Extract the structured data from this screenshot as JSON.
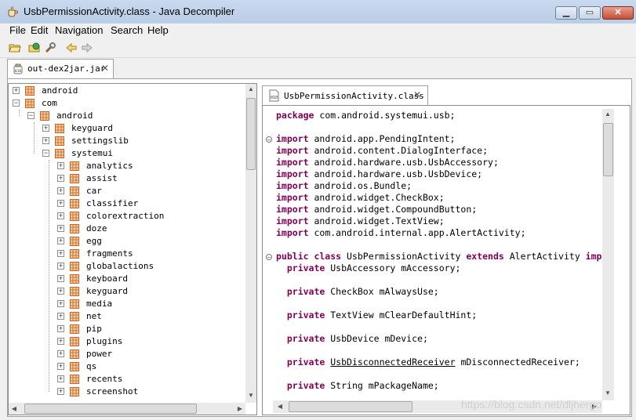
{
  "window": {
    "title": "UsbPermissionActivity.class - Java Decompiler"
  },
  "menu": [
    "File",
    "Edit",
    "Navigation",
    "Search",
    "Help"
  ],
  "toolbar": {
    "icons": [
      "open-folder-icon",
      "open-type-icon",
      "wrench-icon",
      "back-arrow-icon",
      "forward-arrow-icon"
    ]
  },
  "outer_tab": {
    "label": "out-dex2jar.jar"
  },
  "tree": [
    {
      "label": "android",
      "depth": 0,
      "expanded": false
    },
    {
      "label": "com",
      "depth": 0,
      "expanded": true
    },
    {
      "label": "android",
      "depth": 1,
      "expanded": true
    },
    {
      "label": "keyguard",
      "depth": 2,
      "expanded": false
    },
    {
      "label": "settingslib",
      "depth": 2,
      "expanded": false
    },
    {
      "label": "systemui",
      "depth": 2,
      "expanded": true
    },
    {
      "label": "analytics",
      "depth": 3,
      "expanded": false
    },
    {
      "label": "assist",
      "depth": 3,
      "expanded": false
    },
    {
      "label": "car",
      "depth": 3,
      "expanded": false
    },
    {
      "label": "classifier",
      "depth": 3,
      "expanded": false
    },
    {
      "label": "colorextraction",
      "depth": 3,
      "expanded": false
    },
    {
      "label": "doze",
      "depth": 3,
      "expanded": false
    },
    {
      "label": "egg",
      "depth": 3,
      "expanded": false
    },
    {
      "label": "fragments",
      "depth": 3,
      "expanded": false
    },
    {
      "label": "globalactions",
      "depth": 3,
      "expanded": false
    },
    {
      "label": "keyboard",
      "depth": 3,
      "expanded": false
    },
    {
      "label": "keyguard",
      "depth": 3,
      "expanded": false
    },
    {
      "label": "media",
      "depth": 3,
      "expanded": false
    },
    {
      "label": "net",
      "depth": 3,
      "expanded": false
    },
    {
      "label": "pip",
      "depth": 3,
      "expanded": false
    },
    {
      "label": "plugins",
      "depth": 3,
      "expanded": false
    },
    {
      "label": "power",
      "depth": 3,
      "expanded": false
    },
    {
      "label": "qs",
      "depth": 3,
      "expanded": false
    },
    {
      "label": "recents",
      "depth": 3,
      "expanded": false
    },
    {
      "label": "screenshot",
      "depth": 3,
      "expanded": false
    }
  ],
  "code_tab": {
    "label": "UsbPermissionActivity.class"
  },
  "code": [
    {
      "parts": [
        {
          "t": "package",
          "k": true
        },
        {
          "t": " com.android.systemui.usb;"
        }
      ]
    },
    {
      "parts": []
    },
    {
      "parts": [
        {
          "t": "import",
          "k": true
        },
        {
          "t": " android.app.PendingIntent;"
        }
      ],
      "fold": true
    },
    {
      "parts": [
        {
          "t": "import",
          "k": true
        },
        {
          "t": " android.content.DialogInterface;"
        }
      ]
    },
    {
      "parts": [
        {
          "t": "import",
          "k": true
        },
        {
          "t": " android.hardware.usb.UsbAccessory;"
        }
      ]
    },
    {
      "parts": [
        {
          "t": "import",
          "k": true
        },
        {
          "t": " android.hardware.usb.UsbDevice;"
        }
      ]
    },
    {
      "parts": [
        {
          "t": "import",
          "k": true
        },
        {
          "t": " android.os.Bundle;"
        }
      ]
    },
    {
      "parts": [
        {
          "t": "import",
          "k": true
        },
        {
          "t": " android.widget.CheckBox;"
        }
      ]
    },
    {
      "parts": [
        {
          "t": "import",
          "k": true
        },
        {
          "t": " android.widget.CompoundButton;"
        }
      ]
    },
    {
      "parts": [
        {
          "t": "import",
          "k": true
        },
        {
          "t": " android.widget.TextView;"
        }
      ]
    },
    {
      "parts": [
        {
          "t": "import",
          "k": true
        },
        {
          "t": " com.android.internal.app.AlertActivity;"
        }
      ]
    },
    {
      "parts": []
    },
    {
      "parts": [
        {
          "t": "public class",
          "k": true
        },
        {
          "t": " UsbPermissionActivity "
        },
        {
          "t": "extends",
          "k": true
        },
        {
          "t": " AlertActivity "
        },
        {
          "t": "imp",
          "k": true
        }
      ],
      "fold": true
    },
    {
      "parts": [
        {
          "t": "  "
        },
        {
          "t": "private",
          "k": true
        },
        {
          "t": " UsbAccessory mAccessory;"
        }
      ]
    },
    {
      "parts": []
    },
    {
      "parts": [
        {
          "t": "  "
        },
        {
          "t": "private",
          "k": true
        },
        {
          "t": " CheckBox mAlwaysUse;"
        }
      ]
    },
    {
      "parts": []
    },
    {
      "parts": [
        {
          "t": "  "
        },
        {
          "t": "private",
          "k": true
        },
        {
          "t": " TextView mClearDefaultHint;"
        }
      ]
    },
    {
      "parts": []
    },
    {
      "parts": [
        {
          "t": "  "
        },
        {
          "t": "private",
          "k": true
        },
        {
          "t": " UsbDevice mDevice;"
        }
      ]
    },
    {
      "parts": []
    },
    {
      "parts": [
        {
          "t": "  "
        },
        {
          "t": "private",
          "k": true
        },
        {
          "t": " "
        },
        {
          "t": "UsbDisconnectedReceiver",
          "u": true
        },
        {
          "t": " mDisconnectedReceiver;"
        }
      ]
    },
    {
      "parts": []
    },
    {
      "parts": [
        {
          "t": "  "
        },
        {
          "t": "private",
          "k": true
        },
        {
          "t": " String mPackageName;"
        }
      ]
    }
  ],
  "watermark": "https://blog.csdn.net/dljhergo",
  "colors": {
    "keyword": "#7f0055",
    "package_icon": "#c8641e"
  }
}
